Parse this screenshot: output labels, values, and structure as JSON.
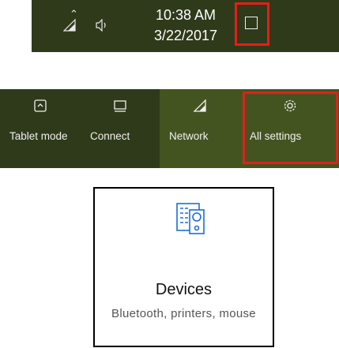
{
  "taskbar": {
    "time": "10:38 AM",
    "date": "3/22/2017",
    "icons": {
      "overflow": "chevron-up-icon",
      "network": "network-icon",
      "volume": "volume-icon",
      "notifications": "notification-center-icon"
    },
    "background": "#2f3a1a",
    "highlight_color": "#e0201a"
  },
  "action_center": {
    "tiles": [
      {
        "label": "Tablet mode",
        "icon": "tablet-mode-icon"
      },
      {
        "label": "Connect",
        "icon": "connect-icon"
      },
      {
        "label": "Network",
        "icon": "network-icon"
      },
      {
        "label": "All settings",
        "icon": "gear-icon"
      }
    ],
    "tile_color": "#2f3a1a",
    "active_tile_color": "#445420"
  },
  "settings_tile": {
    "title": "Devices",
    "description": "Bluetooth, printers, mouse",
    "icon": "devices-icon",
    "icon_color": "#1a6fd4"
  }
}
